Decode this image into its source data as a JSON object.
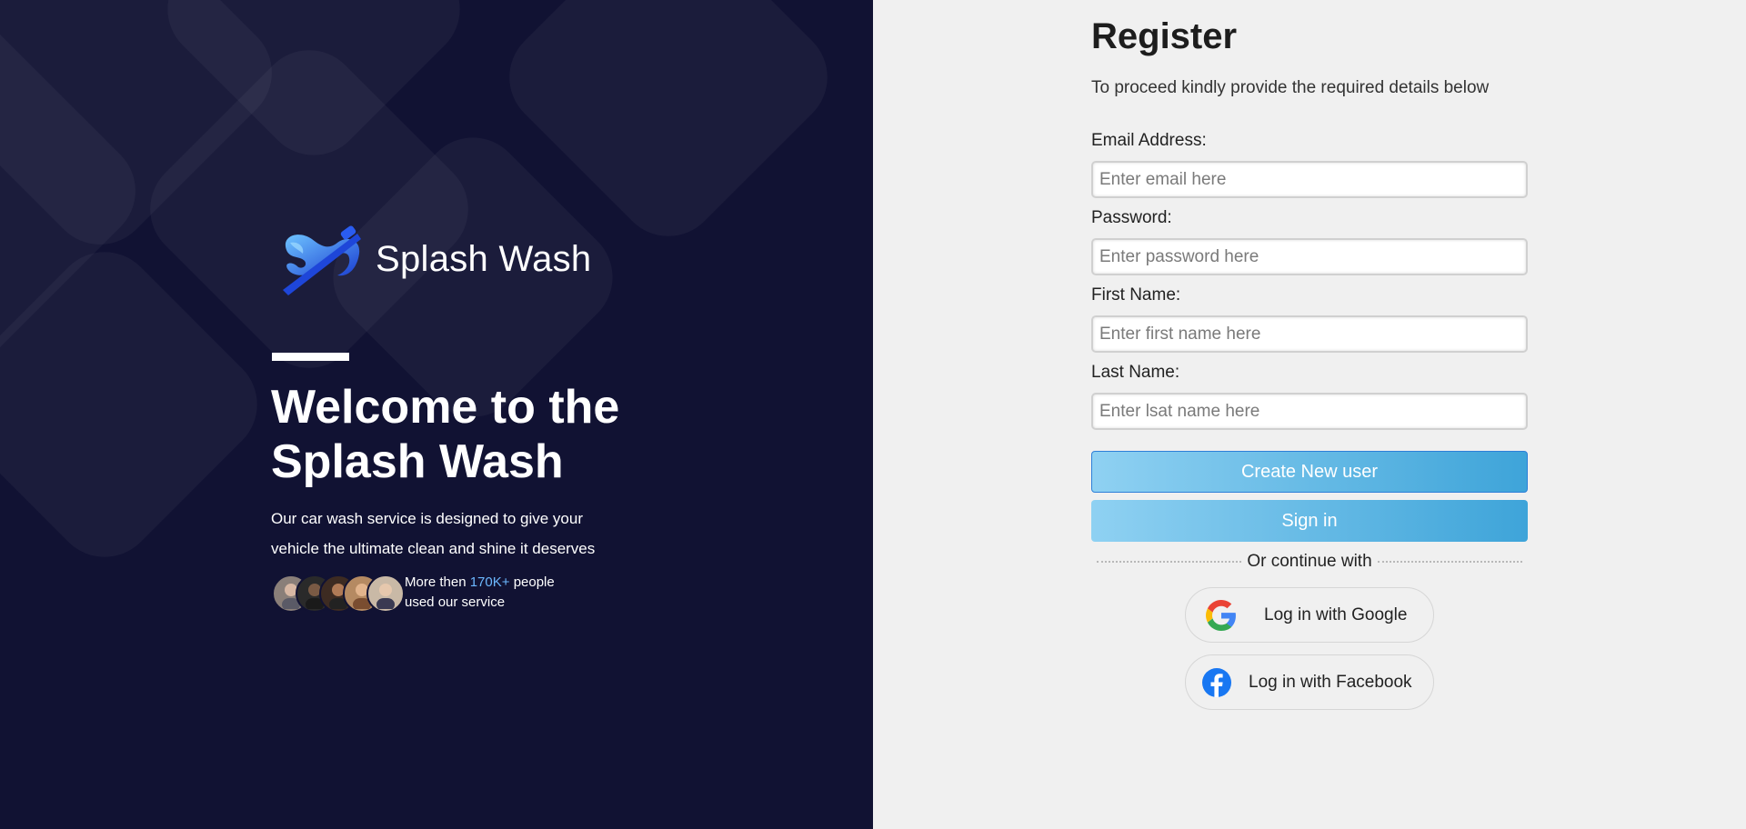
{
  "brand": {
    "name": "Splash Wash",
    "logo_icon": "splash-wash-logo-icon"
  },
  "hero": {
    "title": "Welcome to the Splash Wash",
    "description": "Our car wash service is designed to give your vehicle the ultimate clean and shine it deserves",
    "proof_prefix": "More then",
    "proof_count": "170K+",
    "proof_suffix": "people used our service"
  },
  "form": {
    "title": "Register",
    "subtitle": "To proceed kindly provide the required details below",
    "email": {
      "label": "Email Address:",
      "placeholder": "Enter email here",
      "value": ""
    },
    "password": {
      "label": "Password:",
      "placeholder": "Enter password here",
      "value": ""
    },
    "first_name": {
      "label": "First Name:",
      "placeholder": "Enter first name here",
      "value": ""
    },
    "last_name": {
      "label": "Last Name:",
      "placeholder": "Enter lsat name here",
      "value": ""
    },
    "create_button": "Create New user",
    "signin_button": "Sign in",
    "divider_text": "Or continue with",
    "google_button": "Log in with Google",
    "facebook_button": "Log in with Facebook"
  },
  "colors": {
    "left_bg": "#111233",
    "right_bg": "#f0f0f0",
    "accent_highlight": "#6cb8ff",
    "button_gradient_start": "#8fd1f2",
    "button_gradient_end": "#3ea4d9",
    "facebook_blue": "#1877f2"
  }
}
